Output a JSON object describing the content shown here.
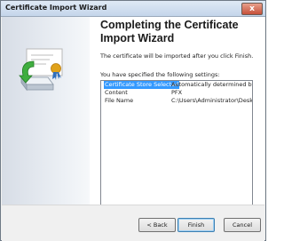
{
  "window": {
    "title": "Certificate Import Wizard",
    "close_glyph": "x"
  },
  "side": {
    "art_icon": "certificate-install-icon"
  },
  "main": {
    "heading": "Completing the Certificate Import Wizard",
    "info": "The certificate will be imported after you click Finish.",
    "specified_label": "You have specified the following settings:",
    "settings": [
      {
        "name": "Certificate Store Selected",
        "value": "Automatically determined by t"
      },
      {
        "name": "Content",
        "value": "PFX"
      },
      {
        "name": "File Name",
        "value": "C:\\Users\\Administrator\\Deskto"
      }
    ],
    "selected_row": 0
  },
  "footer": {
    "back_label": "< Back",
    "finish_label": "Finish",
    "cancel_label": "Cancel"
  },
  "colors": {
    "selection": "#3399ff",
    "side_panel": "#d7dde6",
    "dialog_bg": "#f0f0f0"
  }
}
